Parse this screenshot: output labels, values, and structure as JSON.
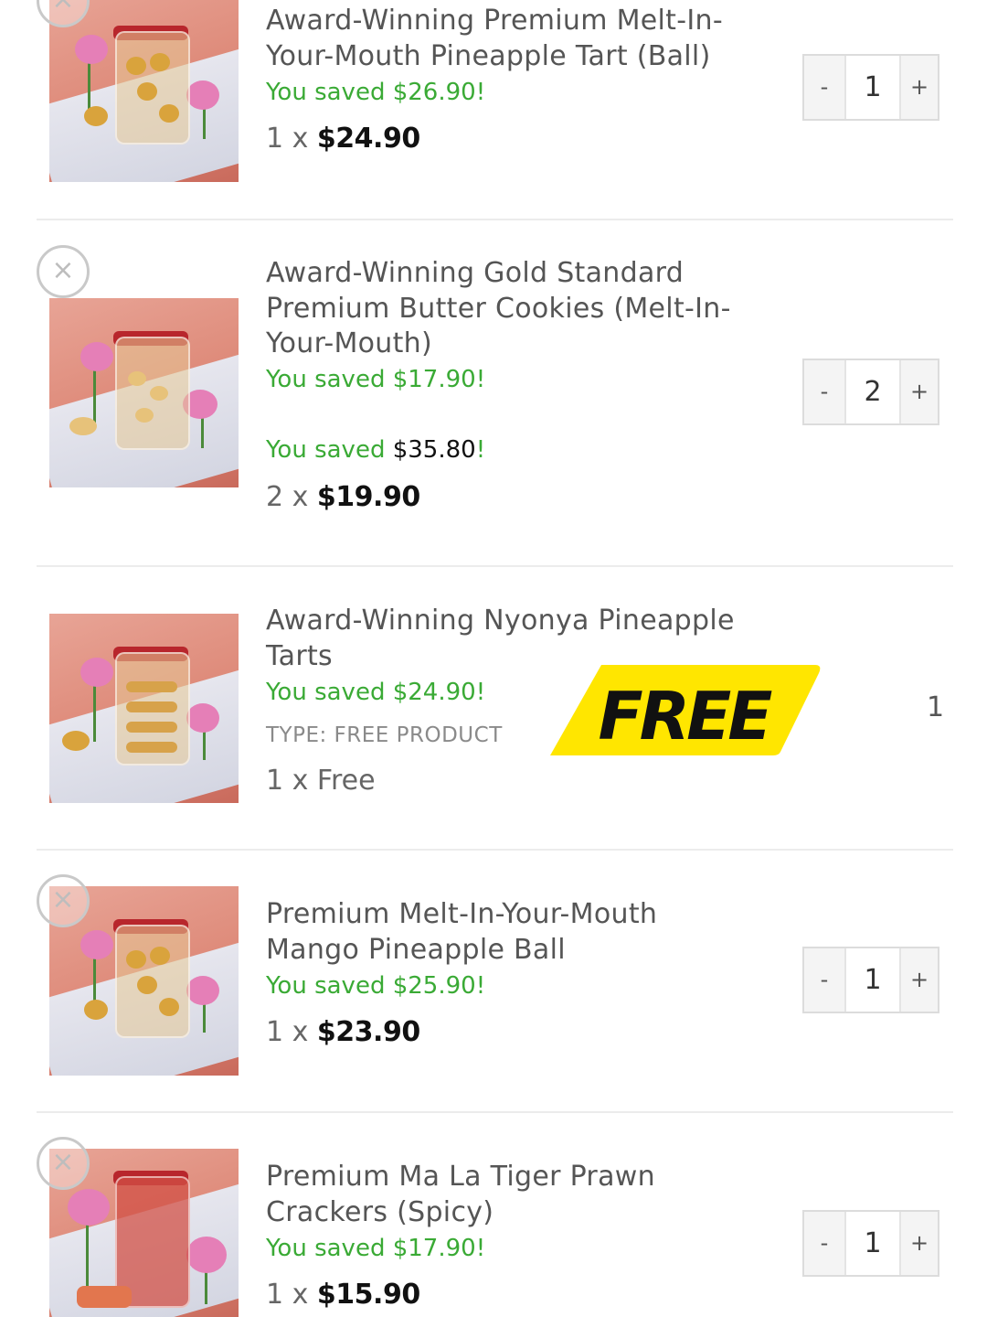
{
  "cart": {
    "items": [
      {
        "title_lines": [
          "Award-Winning Premium Melt-In-",
          "Your-Mouth Pineapple Tart (Ball)"
        ],
        "saved_prefix": "You saved ",
        "saved_amount": "$26.90",
        "saved_suffix": "!",
        "qty_prefix": "1 x ",
        "price": "$24.90",
        "stepper": {
          "minus": "-",
          "value": "1",
          "plus": "+"
        },
        "remove_icon": "×"
      },
      {
        "title_lines": [
          "Award-Winning Gold Standard",
          "Premium Butter Cookies (Melt-In-",
          "Your-Mouth)"
        ],
        "saved_prefix": "You saved ",
        "saved_amount": "$17.90",
        "saved_suffix": "!",
        "saved_total_prefix": "You saved ",
        "saved_total_amount": "$35.80",
        "saved_total_suffix": "!",
        "qty_prefix": "2 x ",
        "price": "$19.90",
        "stepper": {
          "minus": "-",
          "value": "2",
          "plus": "+"
        },
        "remove_icon": "×"
      },
      {
        "title_lines": [
          "Award-Winning Nyonya Pineapple",
          "Tarts"
        ],
        "saved_prefix": "You saved ",
        "saved_amount": "$24.90",
        "saved_suffix": "!",
        "type_label": "TYPE:  FREE PRODUCT",
        "qty_prefix": "1 x ",
        "price_text": "Free",
        "badge_text": "FREE",
        "quantity": "1"
      },
      {
        "title_lines": [
          "Premium Melt-In-Your-Mouth",
          "Mango Pineapple Ball"
        ],
        "saved_prefix": "You saved ",
        "saved_amount": "$25.90",
        "saved_suffix": "!",
        "qty_prefix": "1 x ",
        "price": "$23.90",
        "stepper": {
          "minus": "-",
          "value": "1",
          "plus": "+"
        },
        "remove_icon": "×"
      },
      {
        "title_lines": [
          "Premium Ma La Tiger Prawn",
          "Crackers (Spicy)"
        ],
        "saved_prefix": "You saved ",
        "saved_amount": "$17.90",
        "saved_suffix": "!",
        "qty_prefix": "1 x ",
        "price": "$15.90",
        "stepper": {
          "minus": "-",
          "value": "1",
          "plus": "+"
        },
        "remove_icon": "×"
      }
    ]
  },
  "colors": {
    "saved_green": "#3aaa35",
    "badge_yellow": "#ffe600",
    "badge_text": "#111111"
  }
}
